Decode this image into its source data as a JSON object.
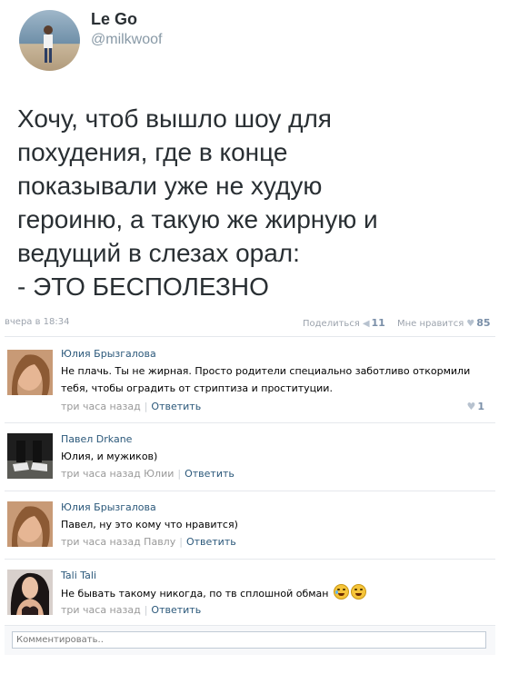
{
  "tweet": {
    "author_name": "Le Go",
    "author_handle": "@milkwoof",
    "text_lines": [
      "Хочу, чтоб вышло шоу для",
      "похудения, где в конце",
      "показывали уже не худую",
      "героиню, а такую же жирную и",
      "ведущий в слезах орал:",
      "- ЭТО БЕСПОЛЕЗНО"
    ]
  },
  "post_meta": {
    "date": "вчера в 18:34",
    "share_label": "Поделиться",
    "share_count": "11",
    "likes_label": "Мне нравится",
    "likes_count": "85",
    "share_icon": "megaphone-icon",
    "like_icon": "heart-icon"
  },
  "comments": [
    {
      "author": "Юлия Брызгалова",
      "text": "Не плачь. Ты не жирная. Просто родители специально заботливо откормили тебя, чтобы оградить от стриптиза и проституции.",
      "time": "три часа назад",
      "reply_label": "Ответить",
      "likes": "1"
    },
    {
      "author": "Павел Drkane",
      "text": "Юлия, и мужиков)",
      "time": "три часа назад Юлии",
      "reply_label": "Ответить"
    },
    {
      "author": "Юлия Брызгалова",
      "text": "Павел, ну это кому что нравится)",
      "time": "три часа назад Павлу",
      "reply_label": "Ответить"
    },
    {
      "author": "Tali Tali",
      "text": "Не бывать такому никогда, по тв сплошной обман",
      "time": "три часа назад",
      "reply_label": "Ответить"
    }
  ],
  "comment_input": {
    "placeholder": "Комментировать.."
  },
  "colors": {
    "link": "#2b587a",
    "muted": "#999999",
    "tweet_text": "#292f33"
  }
}
